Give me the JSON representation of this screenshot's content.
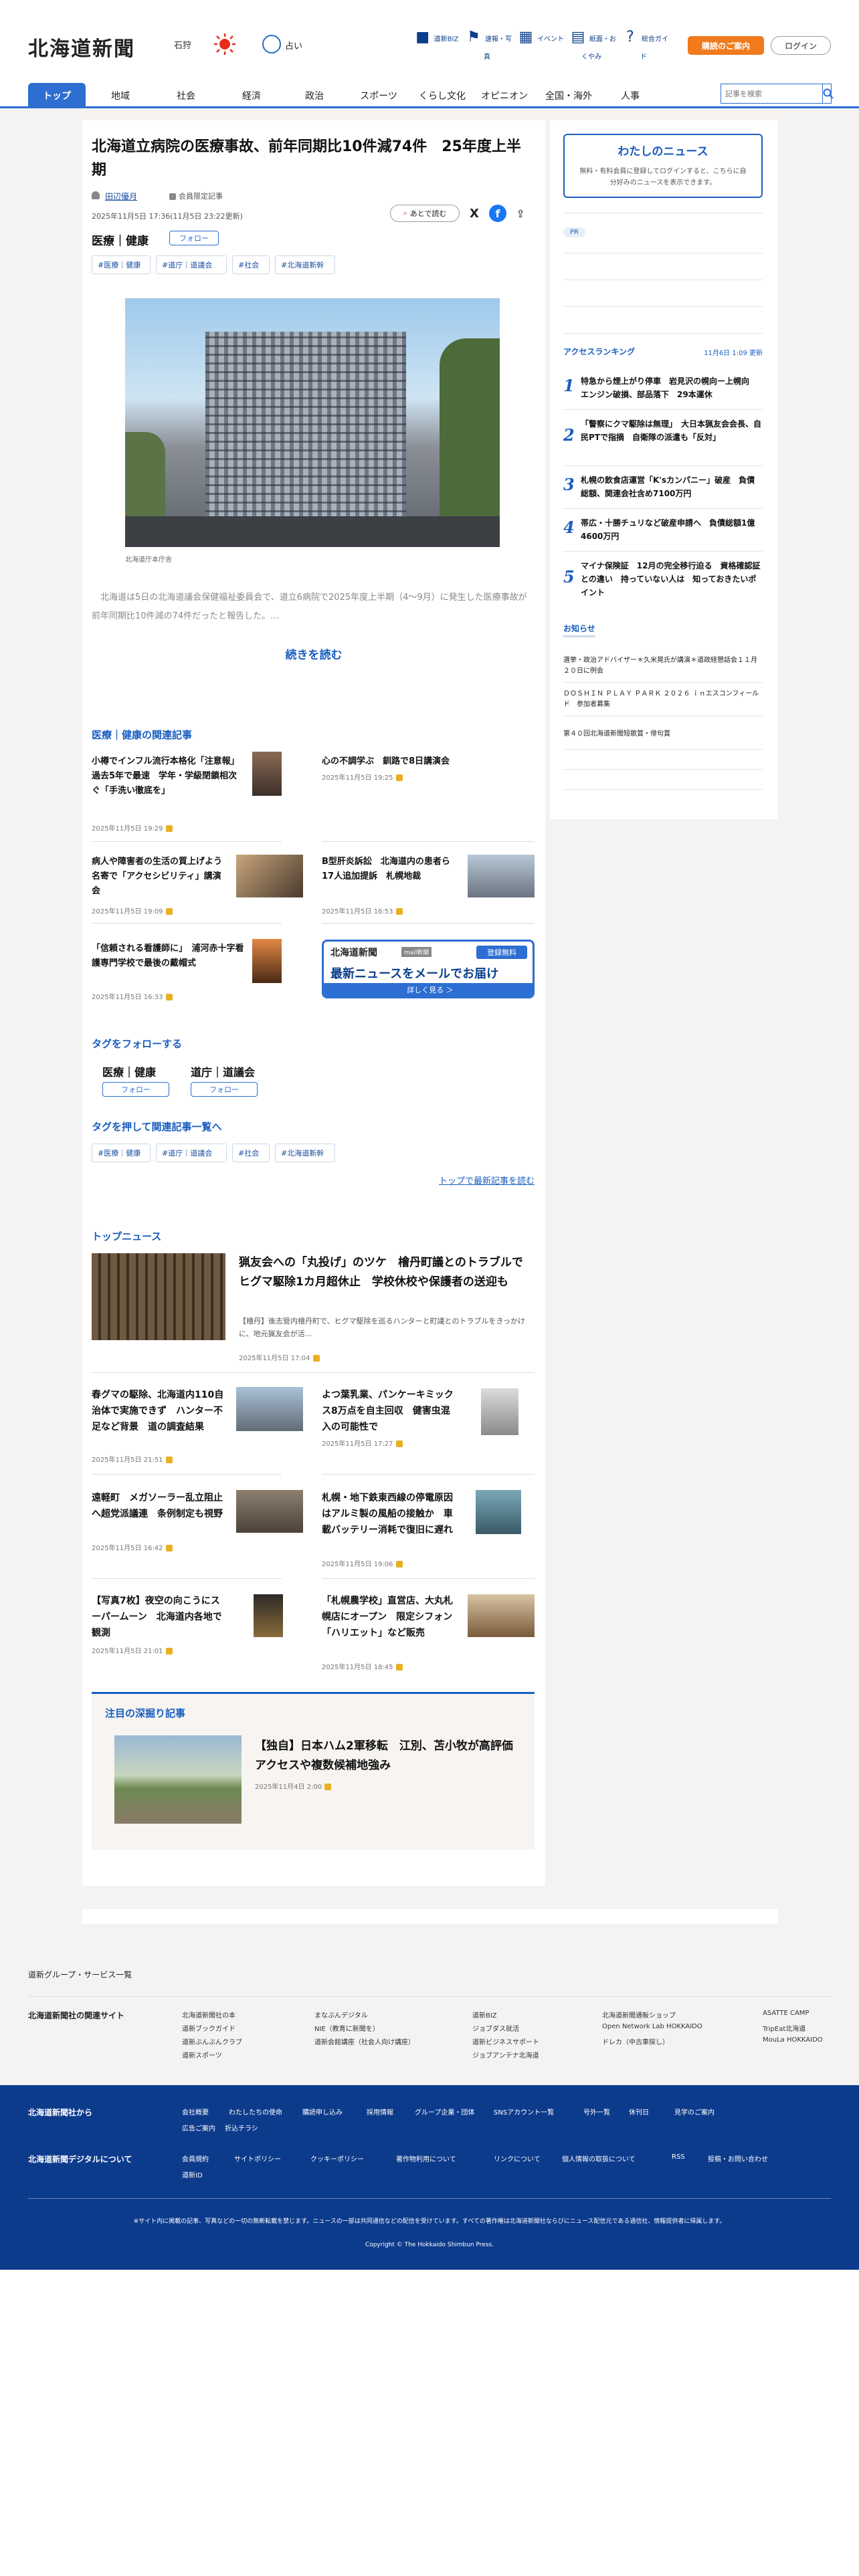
{
  "header": {
    "logo": "北海道新聞",
    "weather_area": "石狩",
    "fortune": "占い",
    "nav_icons": [
      {
        "label": "道新BIZ",
        "icon": "bookmark-icon"
      },
      {
        "label": "速報・写真",
        "icon": "flag-icon"
      },
      {
        "label": "イベント",
        "icon": "calendar-icon"
      },
      {
        "label": "紙面・おくやみ",
        "icon": "newspaper-icon"
      },
      {
        "label": "総合ガイド",
        "icon": "help-icon"
      }
    ],
    "subscribe": "購読のご案内",
    "login": "ログイン"
  },
  "nav": {
    "items": [
      "トップ",
      "地域",
      "社会",
      "経済",
      "政治",
      "スポーツ",
      "くらし文化",
      "オピニオン",
      "全国・海外",
      "人事"
    ],
    "search_placeholder": "記事を検索"
  },
  "article": {
    "title": "北海道立病院の医療事故、前年同期比10件減74件　25年度上半期",
    "author": "田辺優月",
    "member": "会員限定記事",
    "date": "2025年11月5日 17:36(11月5日 23:22更新)",
    "clip": "あとで読む",
    "genre": "医療｜健康",
    "follow": "フォロー",
    "tags": [
      "#医療｜健康",
      "#道庁｜道議会",
      "#社会",
      "#北海道新幹"
    ],
    "photo_caption": "北海道庁本庁舎",
    "lede": "　北海道は5日の北海道議会保健福祉委員会で、道立6病院で2025年度上半期（4〜9月）に発生した医療事故が前年同期比10件減の74件だったと報告した。…",
    "read_more": "続きを読む"
  },
  "related": {
    "heading": "医療｜健康の関連記事",
    "items": [
      {
        "title": "小樽でインフル流行本格化「注意報」過去5年で最速　学年・学級閉鎖相次ぐ「手洗い徹底を」",
        "date": "2025年11月5日 19:29"
      },
      {
        "title": "心の不調学ぶ　釧路で8日講演会",
        "date": "2025年11月5日 19:25"
      },
      {
        "title": "病人や障害者の生活の質上げよう　名寄で「アクセシビリティ」講演会",
        "date": "2025年11月5日 19:09"
      },
      {
        "title": "B型肝炎訴訟　北海道内の患者ら17人追加提訴　札幌地裁",
        "date": "2025年11月5日 16:53"
      },
      {
        "title": "「信頼される看護師に」　浦河赤十字看護専門学校で最後の戴帽式",
        "date": "2025年11月5日 16:33"
      }
    ],
    "mail_banner": {
      "logo": "北海道新聞",
      "badge": "mail新聞",
      "cta": "登録無料",
      "headline": "最新ニュースをメールでお届け",
      "more": "詳しく見る ＞"
    }
  },
  "follow_tags": {
    "heading": "タグをフォローする",
    "items": [
      "医療｜健康",
      "道庁｜道議会"
    ],
    "button": "フォロー"
  },
  "push_tags": {
    "heading": "タグを押して関連記事一覧へ",
    "items": [
      "#医療｜健康",
      "#道庁｜道議会",
      "#社会",
      "#北海道新幹"
    ],
    "toplink": "トップで最新記事を読む"
  },
  "topnews": {
    "heading": "トップニュース",
    "lead": {
      "title": "猟友会への「丸投げ」のツケ　檜丹町議とのトラブルでヒグマ駆除1カ月超休止　学校休校や保護者の送迎も",
      "summary": "【檜丹】後志管内檜丹町で、ヒグマ駆除を巡るハンターと町議とのトラブルをきっかけに、地元猟友会が活...",
      "date": "2025年11月5日 17:04"
    },
    "items": [
      {
        "title": "春グマの駆除、北海道内110自治体で実施できず　ハンター不足など背景　道の調査結果",
        "date": "2025年11月5日 21:51"
      },
      {
        "title": "よつ葉乳業、パンケーキミックス8万点を自主回収　健害虫混入の可能性で",
        "date": "2025年11月5日 17:27"
      },
      {
        "title": "遠軽町　メガソーラー乱立阻止へ超党派議連　条例制定も視野",
        "date": "2025年11月5日 16:42"
      },
      {
        "title": "札幌・地下鉄東西線の停電原因はアルミ製の風船の接触か　車載バッテリー消耗で復旧に遅れ",
        "date": "2025年11月5日 19:06"
      },
      {
        "title": "【写真7枚】夜空の向こうにスーパームーン　北海道内各地で観測",
        "date": "2025年11月5日 21:01"
      },
      {
        "title": "「札幌農学校」直営店、大丸札幌店にオープン　限定シフォン「ハリエット」など販売",
        "date": "2025年11月5日 18:45"
      }
    ]
  },
  "deep": {
    "heading": "注目の深掘り記事",
    "title": "【独自】日本ハム2軍移転　江別、苫小牧が高評価　アクセスや複数候補地強み",
    "date": "2025年11月4日 2:00"
  },
  "sidebar": {
    "mynews_title": "わたしのニュース",
    "mynews_desc": "無料・有料会員に登録してログインすると、こちらに自分好みのニュースを表示できます。",
    "pr": "PR",
    "ranking_heading": "アクセスランキング",
    "ranking_updated": "11月6日 1:09 更新",
    "ranking": [
      {
        "n": "1",
        "title": "特急から煙上がり停車　岩見沢の幌向ー上幌向　エンジン破損、部品落下　29本運休"
      },
      {
        "n": "2",
        "title": "「警察にクマ駆除は無理」　大日本猟友会会長、自民PTで指摘　自衛隊の派遣も「反対」"
      },
      {
        "n": "3",
        "title": "札幌の飲食店運営「K'sカンパニー」破産　負債総額、関連会社含め7100万円"
      },
      {
        "n": "4",
        "title": "帯広・十勝チュリなど破産申請へ　負債総額1億4600万円"
      },
      {
        "n": "5",
        "title": "マイナ保険証　12月の完全移行迫る　資格確認証との違い　持っていない人は　知っておきたいポイント"
      }
    ],
    "notice_heading": "お知らせ",
    "notices": [
      "選挙・政治アドバイザー＊久米晃氏が講演＊道政経懇話会１１月２０日に例会",
      "ＤＯＳＨＩＮ ＰＬＡＹ ＰＡＲＫ ２０２６ ｉｎエスコンフィールド　参加者募集",
      "第４０回北海道新聞短歌賞・俳句賞"
    ]
  },
  "footer": {
    "group": "道新グループ・サービス一覧",
    "related_sites_heading": "北海道新聞社の関連サイト",
    "related_sites": [
      [
        "北海道新聞社の本",
        "道新ブックガイド",
        "道新ぶんぶんクラブ",
        "道新スポーツ"
      ],
      [
        "まなぶんデジタル",
        "NIE（教育に新聞を）",
        "道新会館講座（社会人向け講座）"
      ],
      [
        "道新BIZ",
        "ジョブダス就活",
        "道新ビジネスサポート",
        "ジョブアンテナ北海道"
      ],
      [
        "北海道新聞通販ショップ",
        "Open Network Lab HOKKAIDO",
        "ドレカ（中古車探し）"
      ],
      [
        "ASATTE CAMP",
        "TripEat北海道",
        "MouLa HOKKAIDO"
      ]
    ],
    "company_heading": "北海道新聞社から",
    "company_links": [
      "会社概要",
      "わたしたちの使命",
      "購読申し込み",
      "採用情報",
      "グループ企業・団体",
      "SNSアカウント一覧",
      "号外一覧",
      "休刊日",
      "見学のご案内",
      "広告ご案内",
      "折込チラシ"
    ],
    "digital_heading": "北海道新聞デジタルについて",
    "digital_links": [
      "会員規約",
      "サイトポリシー",
      "クッキーポリシー",
      "著作物利用について",
      "リンクについて",
      "個人情報の取扱について",
      "RSS",
      "投稿・お問い合わせ",
      "道新ID"
    ],
    "disclaimer": "※サイト内に掲載の記事、写真などの一切の無断転載を禁じます。ニュースの一部は共同通信などの配信を受けています。すべての著作権は北海道新聞社ならびにニュース配信元である通信社、情報提供者に帰属します。",
    "copyright": "Copyright © The Hokkaido Shimbun Press."
  },
  "colors": {
    "accent": "#2c6ed1",
    "link": "#1a5ec0",
    "subscribe": "#f07a1c",
    "footer": "#0d3b8c"
  }
}
